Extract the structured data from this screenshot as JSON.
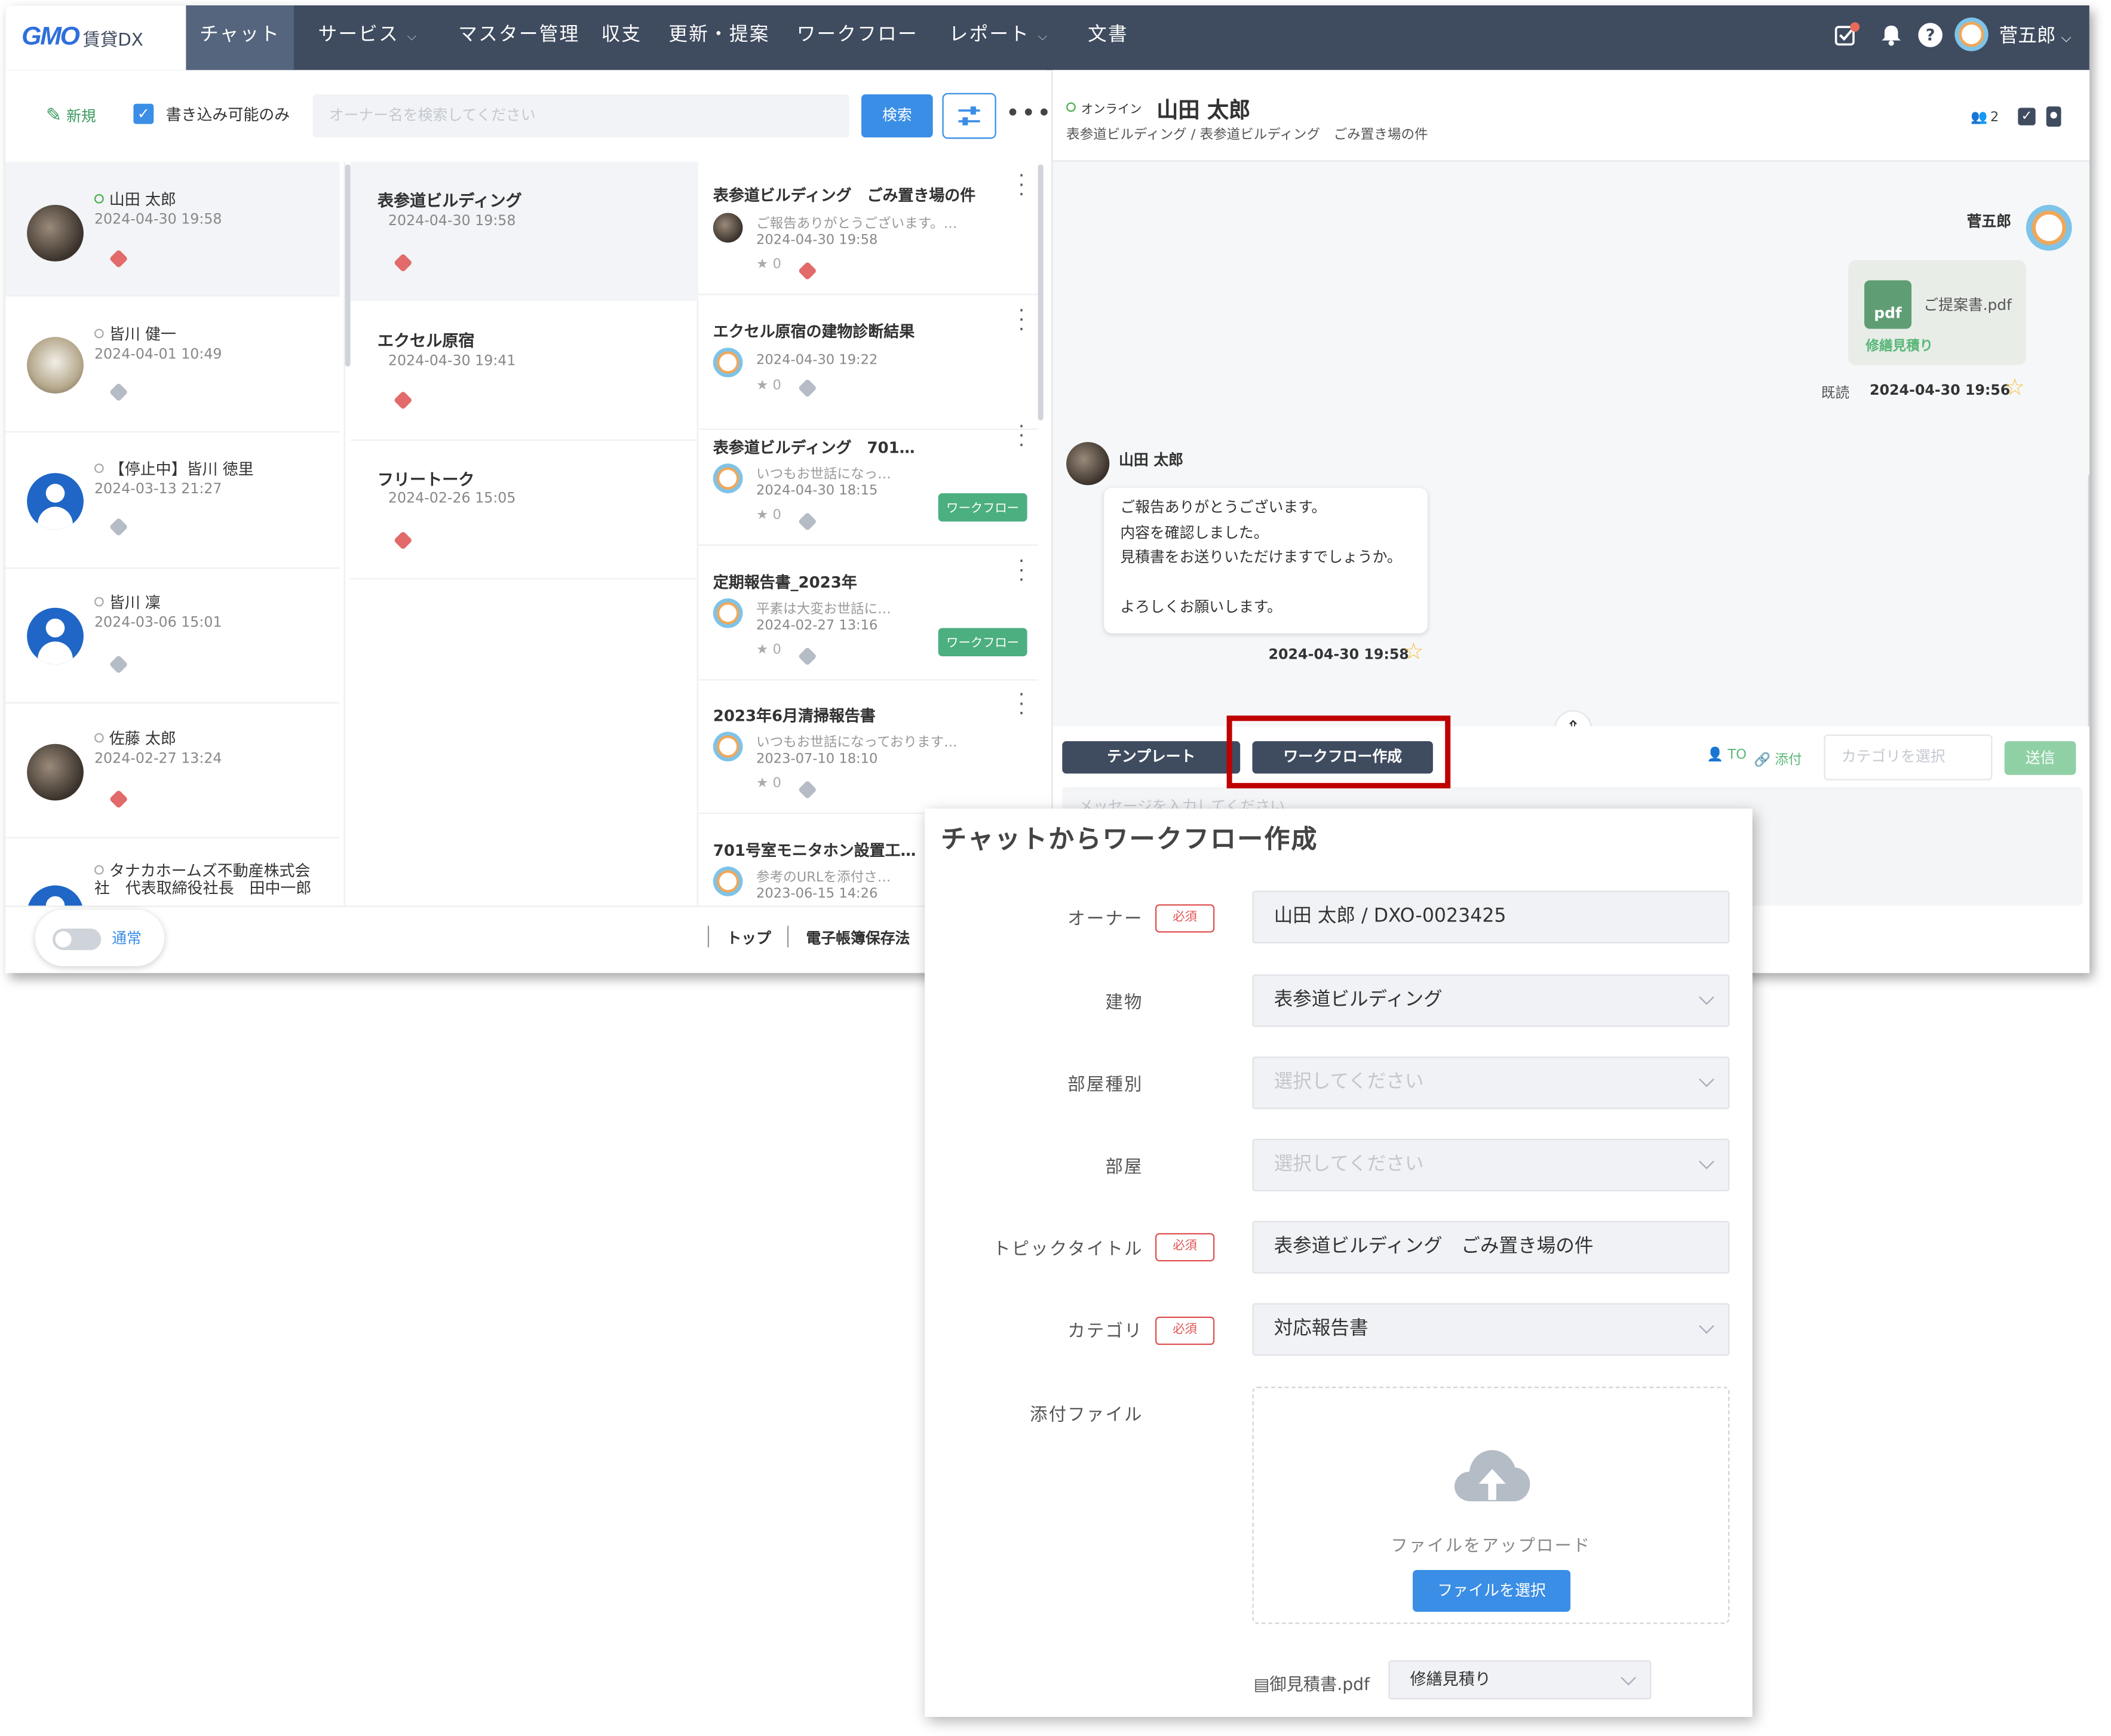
{
  "nav": {
    "logo_gmo": "GMO",
    "logo_text": "賃貸DX",
    "items": [
      {
        "label": "チャット",
        "dropdown": false
      },
      {
        "label": "サービス",
        "dropdown": true
      },
      {
        "label": "マスター管理",
        "dropdown": false
      },
      {
        "label": "収支",
        "dropdown": false
      },
      {
        "label": "更新・提案",
        "dropdown": false
      },
      {
        "label": "ワークフロー",
        "dropdown": false
      },
      {
        "label": "レポート",
        "dropdown": true
      },
      {
        "label": "文書",
        "dropdown": false
      }
    ],
    "user_name": "菅五郎"
  },
  "toolbar": {
    "new_label": "新規",
    "writable_only_label": "書き込み可能のみ",
    "writable_only_checked": true,
    "search_placeholder": "オーナー名を検索してください",
    "search_button": "検索"
  },
  "owners": [
    {
      "name": "山田 太郎",
      "date": "2024-04-30 19:58",
      "tag": "red",
      "avatar": "photo",
      "selected": true
    },
    {
      "name": "皆川 健一",
      "date": "2024-04-01 10:49",
      "tag": "gray",
      "avatar": "cat"
    },
    {
      "name": "【停止中】皆川 徳里",
      "date": "2024-03-13 21:27",
      "tag": "gray",
      "avatar": "default"
    },
    {
      "name": "皆川 凜",
      "date": "2024-03-06 15:01",
      "tag": "gray",
      "avatar": "default"
    },
    {
      "name": "佐藤 太郎",
      "date": "2024-02-27 13:24",
      "tag": "red",
      "avatar": "photo"
    },
    {
      "name_line1": "タナカホームズ不動産株式会",
      "name_line2": "社　代表取締役社長　田中一郎",
      "avatar": "default"
    }
  ],
  "buildings": [
    {
      "title": "表参道ビルディング",
      "date": "2024-04-30 19:58",
      "selected": true
    },
    {
      "title": "エクセル原宿",
      "date": "2024-04-30 19:41"
    },
    {
      "title": "フリートーク",
      "date": "2024-02-26 15:05"
    }
  ],
  "topics": [
    {
      "title": "表参道ビルディング　ごみ置き場の件",
      "preview": "ご報告ありがとうございます。…",
      "date": "2024-04-30 19:58",
      "stars": "0",
      "workflow": false
    },
    {
      "title": "エクセル原宿の建物診断結果",
      "preview": "",
      "date": "2024-04-30 19:22",
      "stars": "0",
      "workflow": false
    },
    {
      "title": "表参道ビルディング　701…",
      "preview": "いつもお世話になっ…",
      "date": "2024-04-30 18:15",
      "stars": "0",
      "workflow": true
    },
    {
      "title": "定期報告書_2023年",
      "preview": "平素は大変お世話に…",
      "date": "2024-02-27 13:16",
      "stars": "0",
      "workflow": true
    },
    {
      "title": "2023年6月清掃報告書",
      "preview": "いつもお世話になっております…",
      "date": "2023-07-10 18:10",
      "stars": "0",
      "workflow": false
    },
    {
      "title": "701号室モニタホン設置工…",
      "preview": "参考のURLを添付さ…",
      "date": "2023-06-15 14:26",
      "stars": "",
      "workflow": false
    }
  ],
  "workflow_badge": "ワークフロー",
  "bottom": {
    "mode_label": "通常",
    "links": [
      "トップ",
      "電子帳簿保存法"
    ]
  },
  "chat": {
    "status": "オンライン",
    "owner_name": "山田 太郎",
    "breadcrumb": "表参道ビルディング / 表参道ビルディング　ごみ置き場の件",
    "member_count": "2",
    "sender_self": "菅五郎",
    "attachment_name": "ご提案書.pdf",
    "attachment_type": "pdf",
    "attachment_category": "修繕見積り",
    "read_label": "既読",
    "self_date": "2024-04-30 19:56",
    "sender_other": "山田 太郎",
    "message_lines": [
      "ご報告ありがとうございます。",
      "内容を確認しました。",
      "見積書をお送りいただけますでしょうか。",
      "",
      "よろしくお願いします。"
    ],
    "other_date": "2024-04-30 19:58",
    "template_button": "テンプレート",
    "workflow_button": "ワークフロー作成",
    "to_label": "TO",
    "attach_label": "添付",
    "category_placeholder": "カテゴリを選択",
    "send_button": "送信",
    "message_placeholder": "メッセージを入力してください"
  },
  "modal": {
    "title": "チャットからワークフロー作成",
    "required_label": "必須",
    "fields": {
      "owner": {
        "label": "オーナー",
        "value": "山田 太郎 / DXO-0023425"
      },
      "building": {
        "label": "建物",
        "value": "表参道ビルディング"
      },
      "room_type": {
        "label": "部屋種別",
        "placeholder": "選択してください"
      },
      "room": {
        "label": "部屋",
        "placeholder": "選択してください"
      },
      "topic_title": {
        "label": "トピックタイトル",
        "value": "表参道ビルディング　ごみ置き場の件"
      },
      "category": {
        "label": "カテゴリ",
        "value": "対応報告書"
      },
      "attachment": {
        "label": "添付ファイル"
      }
    },
    "upload_text": "ファイルをアップロード",
    "upload_button": "ファイルを選択",
    "file_name": "御見積書.pdf",
    "file_category": "修繕見積り"
  },
  "colors": {
    "nav_bg": "#3f4b5f",
    "accent": "#3a8ee6",
    "send": "#5cb87a",
    "highlight": "#c00000",
    "required": "#e05252"
  }
}
